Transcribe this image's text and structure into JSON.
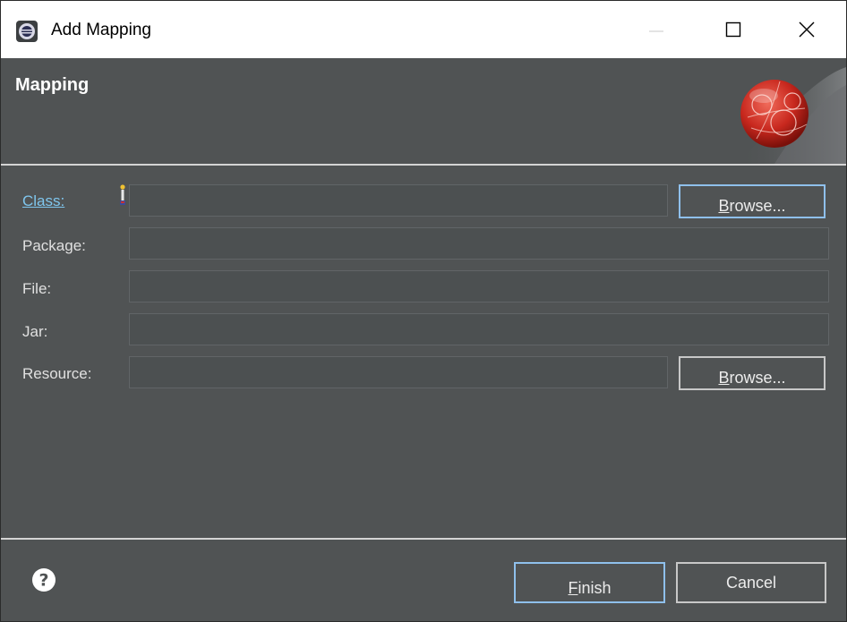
{
  "window": {
    "title": "Add Mapping"
  },
  "banner": {
    "title": "Mapping"
  },
  "form": {
    "class_label": "Class:",
    "class_value": "",
    "package_label": "Package:",
    "package_value": "",
    "file_label": "File:",
    "file_value": "",
    "jar_label": "Jar:",
    "jar_value": "",
    "resource_label": "Resource:",
    "resource_value": "",
    "browse_class": {
      "first": "B",
      "rest": "rowse..."
    },
    "browse_resource": {
      "first": "B",
      "rest": "rowse..."
    }
  },
  "footer": {
    "finish": {
      "first": "F",
      "rest": "inish"
    },
    "cancel_label": "Cancel"
  },
  "icons": {
    "app": "eclipse-icon",
    "minimize": "minimize-icon",
    "maximize": "maximize-icon",
    "close": "close-icon",
    "banner": "mapping-sphere-icon",
    "field_marker": "required-field-marker-icon",
    "help": "help-icon"
  },
  "colors": {
    "background": "#505354",
    "link": "#7fc6ee",
    "focus_border": "#8fc0ec",
    "sphere": "#c8281e"
  }
}
